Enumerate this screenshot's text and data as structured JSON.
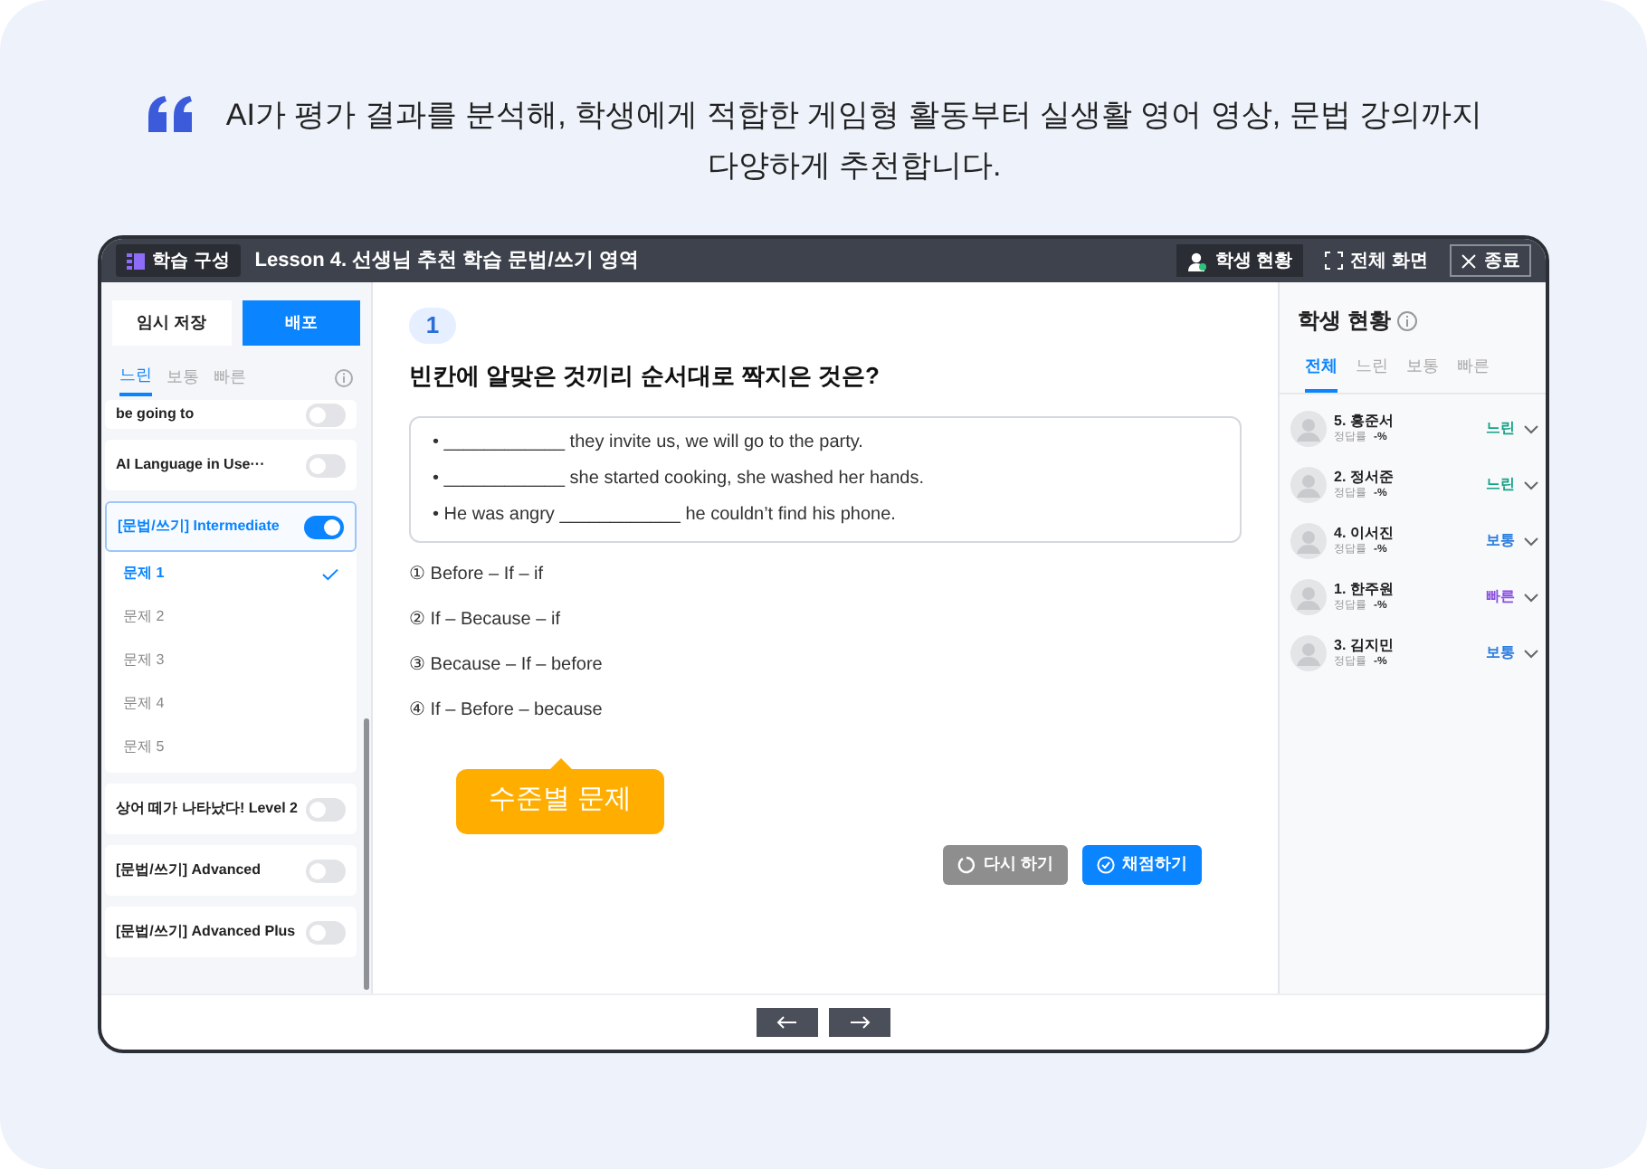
{
  "headline": {
    "text": "AI가 평가 결과를 분석해, 학생에게 적합한 게임형 활동부터 실생활 영어 영상, 문법 강의까지 다양하게 추천합니다."
  },
  "topbar": {
    "badge": "학습 구성",
    "title": "Lesson 4. 선생님 추천 학습 문법/쓰기 영역",
    "buttons": [
      {
        "label": "학생 현황",
        "kind": "students"
      },
      {
        "label": "전체 화면",
        "kind": "fullscreen"
      },
      {
        "label": "종료",
        "kind": "close"
      }
    ]
  },
  "left_panel": {
    "buttons": [
      {
        "label": "임시 저장",
        "kind": "secondary"
      },
      {
        "label": "배포",
        "kind": "primary"
      }
    ],
    "tabs": [
      {
        "label": "느린",
        "selected": true
      },
      {
        "label": "보통",
        "selected": false
      },
      {
        "label": "빠른",
        "selected": false
      }
    ],
    "items": [
      {
        "title": "be going to",
        "on": false,
        "expanded": false
      },
      {
        "title": "AI Language in Use···",
        "on": false,
        "expanded": false
      },
      {
        "title": "[문법/쓰기] Intermediate",
        "on": true,
        "expanded": true,
        "children": [
          {
            "label": "문제 1",
            "selected": true
          },
          {
            "label": "문제 2",
            "selected": false
          },
          {
            "label": "문제 3",
            "selected": false
          },
          {
            "label": "문제 4",
            "selected": false
          },
          {
            "label": "문제 5",
            "selected": false
          }
        ]
      },
      {
        "title": "상어 떼가 나타났다! Level 2",
        "on": false,
        "expanded": false
      },
      {
        "title": "[문법/쓰기] Advanced",
        "on": false,
        "expanded": false
      },
      {
        "title": "[문법/쓰기] Advanced Plus",
        "on": false,
        "expanded": false
      }
    ]
  },
  "question": {
    "number": "1",
    "prompt": "빈칸에 알맞은 것끼리 순서대로 짝지은 것은?",
    "sentences": [
      "• ____________ they invite us, we will go to the party.",
      "• ____________ she started cooking, she washed her hands.",
      "• He was angry ____________ he couldn’t find his phone."
    ],
    "choices": [
      "① Before – If – if",
      "② If – Because – if",
      "③ Because – If – before",
      "④ If – Before – because"
    ],
    "tooltip": "수준별 문제",
    "buttons": [
      {
        "label": "다시 하기",
        "kind": "retry"
      },
      {
        "label": "채점하기",
        "kind": "grade"
      }
    ]
  },
  "right_panel": {
    "title": "학생 현황",
    "tabs": [
      {
        "label": "전체",
        "selected": true
      },
      {
        "label": "느린",
        "selected": false
      },
      {
        "label": "보통",
        "selected": false
      },
      {
        "label": "빠른",
        "selected": false
      }
    ],
    "students": [
      {
        "name": "5. 홍준서",
        "rate_label": "정답률",
        "rate": "-%",
        "level": "느린",
        "color": "#16a386"
      },
      {
        "name": "2. 정서준",
        "rate_label": "정답률",
        "rate": "-%",
        "level": "느린",
        "color": "#16a386"
      },
      {
        "name": "4. 이서진",
        "rate_label": "정답률",
        "rate": "-%",
        "level": "보통",
        "color": "#2b7de0"
      },
      {
        "name": "1. 한주원",
        "rate_label": "정답률",
        "rate": "-%",
        "level": "빠른",
        "color": "#8a4fe0"
      },
      {
        "name": "3. 김지민",
        "rate_label": "정답률",
        "rate": "-%",
        "level": "보통",
        "color": "#2b7de0"
      }
    ]
  }
}
